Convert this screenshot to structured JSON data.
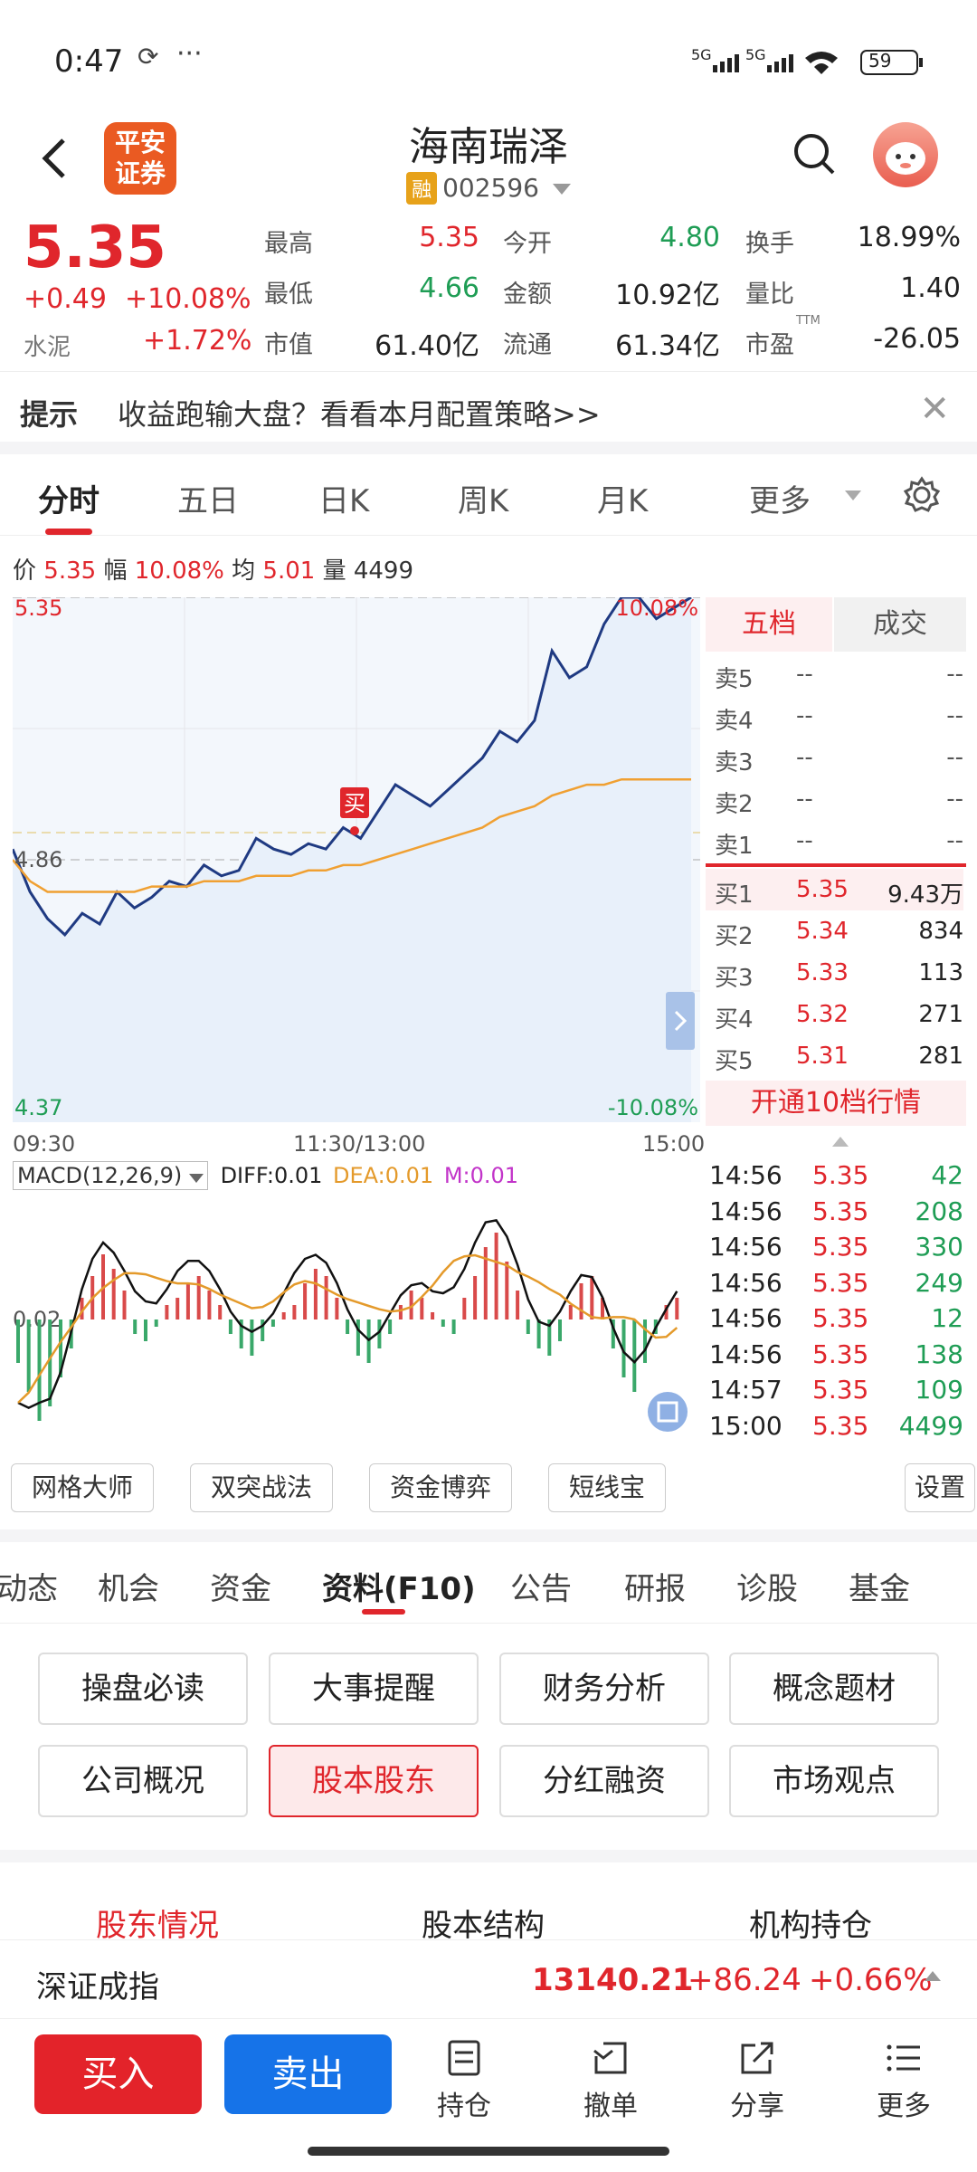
{
  "status": {
    "time": "0:47",
    "sync_glyph": "⟳",
    "dots": "···",
    "network": "5G 5G",
    "battery": "59"
  },
  "header": {
    "logo_line1": "平安",
    "logo_line2": "证券",
    "stock_name": "海南瑞泽",
    "margin_tag": "融",
    "code": "002596"
  },
  "quote": {
    "price": "5.35",
    "change": "+0.49",
    "change_pct": "+10.08%",
    "sector": "水泥",
    "sector_pct": "+1.72%",
    "rows": [
      [
        {
          "l": "最高",
          "v": "5.35",
          "c": "red"
        },
        {
          "l": "今开",
          "v": "4.80",
          "c": "green"
        },
        {
          "l": "换手",
          "v": "18.99%",
          "c": "dark"
        }
      ],
      [
        {
          "l": "最低",
          "v": "4.66",
          "c": "green"
        },
        {
          "l": "金额",
          "v": "10.92亿",
          "c": "dark"
        },
        {
          "l": "量比",
          "v": "1.40",
          "c": "dark"
        }
      ],
      [
        {
          "l": "市值",
          "v": "61.40亿",
          "c": "dark"
        },
        {
          "l": "流通",
          "v": "61.34亿",
          "c": "dark"
        },
        {
          "l": "市盈",
          "v": "-26.05",
          "c": "dark"
        }
      ]
    ],
    "ttm": "TTM"
  },
  "tip": {
    "label": "提示",
    "text": "收益跑输大盘？看看本月配置策略>>",
    "close": "✕"
  },
  "chart_tabs": [
    "分时",
    "五日",
    "日K",
    "周K",
    "月K",
    "更多"
  ],
  "info_line": {
    "price_label": "价",
    "price": "5.35",
    "amp_label": "幅",
    "amp": "10.08%",
    "avg_label": "均",
    "avg": "5.01",
    "vol_label": "量",
    "vol": "4499"
  },
  "chart_data": {
    "type": "line",
    "title": "",
    "x_labels": [
      "09:30",
      "11:30/13:00",
      "15:00"
    ],
    "y_top": "5.35",
    "y_mid": "4.86",
    "y_bottom": "4.37",
    "pct_top": "10.08%",
    "pct_bottom": "-10.08%",
    "ylim": [
      4.37,
      5.35
    ],
    "buy_marker": "买",
    "series": [
      {
        "values": [
          4.88,
          4.8,
          4.75,
          4.72,
          4.76,
          4.74,
          4.8,
          4.77,
          4.79,
          4.82,
          4.81,
          4.85,
          4.83,
          4.84,
          4.9,
          4.88,
          4.87,
          4.89,
          4.88,
          4.92,
          4.9,
          4.95,
          5.0,
          4.98,
          4.96,
          4.99,
          5.02,
          5.05,
          5.1,
          5.08,
          5.12,
          5.25,
          5.2,
          5.22,
          5.3,
          5.35,
          5.35,
          5.31,
          5.33,
          5.35
        ]
      },
      {
        "values": [
          4.86,
          4.82,
          4.8,
          4.8,
          4.8,
          4.8,
          4.8,
          4.8,
          4.81,
          4.81,
          4.81,
          4.82,
          4.82,
          4.82,
          4.83,
          4.83,
          4.83,
          4.84,
          4.84,
          4.85,
          4.85,
          4.86,
          4.87,
          4.88,
          4.89,
          4.9,
          4.91,
          4.92,
          4.94,
          4.95,
          4.96,
          4.98,
          4.99,
          5.0,
          5.0,
          5.01,
          5.01,
          5.01,
          5.01,
          5.01
        ]
      }
    ]
  },
  "macd": {
    "label": "MACD(12,26,9)",
    "diff_label": "DIFF:0.01",
    "dea_label": "DEA:0.01",
    "m_label": "M:0.01",
    "y_label": "0.02",
    "bars": [
      -6,
      -10,
      -14,
      -12,
      -8,
      -4,
      3,
      6,
      9,
      7,
      4,
      -2,
      -3,
      -1,
      2,
      3,
      5,
      6,
      4,
      2,
      -2,
      -4,
      -5,
      -3,
      -1,
      1,
      2,
      5,
      7,
      6,
      3,
      -2,
      -5,
      -6,
      -4,
      -2,
      2,
      4,
      3,
      1,
      -1,
      -2,
      3,
      6,
      10,
      12,
      8,
      4,
      -2,
      -4,
      -5,
      -3,
      2,
      5,
      6,
      3,
      -4,
      -8,
      -10,
      -6,
      -2,
      2,
      3
    ]
  },
  "order_book": {
    "tab_five": "五档",
    "tab_deals": "成交",
    "asks": [
      {
        "l": "卖5",
        "p": "--",
        "v": "--"
      },
      {
        "l": "卖4",
        "p": "--",
        "v": "--"
      },
      {
        "l": "卖3",
        "p": "--",
        "v": "--"
      },
      {
        "l": "卖2",
        "p": "--",
        "v": "--"
      },
      {
        "l": "卖1",
        "p": "--",
        "v": "--"
      }
    ],
    "bids": [
      {
        "l": "买1",
        "p": "5.35",
        "v": "9.43万"
      },
      {
        "l": "买2",
        "p": "5.34",
        "v": "834"
      },
      {
        "l": "买3",
        "p": "5.33",
        "v": "113"
      },
      {
        "l": "买4",
        "p": "5.32",
        "v": "271"
      },
      {
        "l": "买5",
        "p": "5.31",
        "v": "281"
      }
    ],
    "level10": "开通10档行情",
    "ticks": [
      {
        "t": "14:56",
        "p": "5.35",
        "v": "42"
      },
      {
        "t": "14:56",
        "p": "5.35",
        "v": "208"
      },
      {
        "t": "14:56",
        "p": "5.35",
        "v": "330"
      },
      {
        "t": "14:56",
        "p": "5.35",
        "v": "249"
      },
      {
        "t": "14:56",
        "p": "5.35",
        "v": "12"
      },
      {
        "t": "14:56",
        "p": "5.35",
        "v": "138"
      },
      {
        "t": "14:57",
        "p": "5.35",
        "v": "109"
      },
      {
        "t": "15:00",
        "p": "5.35",
        "v": "4499"
      }
    ]
  },
  "tools": [
    "网格大师",
    "双突战法",
    "资金博弈",
    "短线宝",
    "设置"
  ],
  "f10_tabs": [
    "动态",
    "机会",
    "资金",
    "资料(F10)",
    "公告",
    "研报",
    "诊股",
    "基金"
  ],
  "f10_buttons": [
    "操盘必读",
    "大事提醒",
    "财务分析",
    "概念题材",
    "公司概况",
    "股本股东",
    "分红融资",
    "市场观点"
  ],
  "sub_tabs": [
    "股东情况",
    "股本结构",
    "机构持仓"
  ],
  "index_bar": {
    "name": "深证成指",
    "value": "13140.21",
    "change": "+86.24",
    "pct": "+0.66%"
  },
  "bottom": {
    "buy": "买入",
    "sell": "卖出",
    "nav": [
      "持仓",
      "撤单",
      "分享",
      "更多"
    ]
  }
}
